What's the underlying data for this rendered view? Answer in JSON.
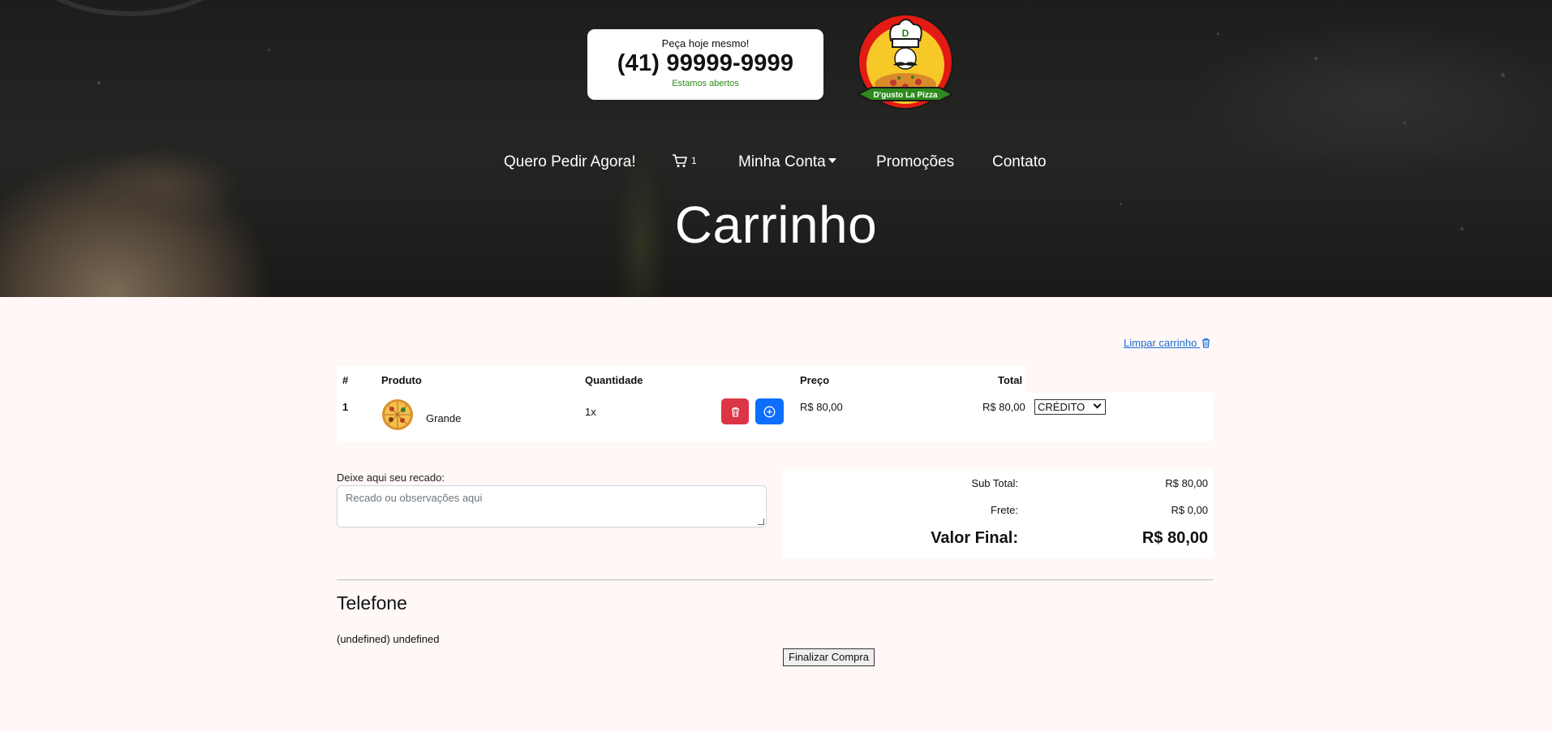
{
  "header": {
    "call_prompt": "Peça hoje mesmo!",
    "phone": "(41) 99999-9999",
    "open_status": "Estamos abertos",
    "logo_text": "D'gusto La Pizza",
    "logo_letter": "D"
  },
  "nav": {
    "order_now": "Quero Pedir Agora!",
    "cart_count": "1",
    "account": "Minha Conta",
    "promotions": "Promoções",
    "contact": "Contato"
  },
  "page_title": "Carrinho",
  "cart": {
    "clear_label": "Limpar carrinho",
    "columns": [
      "#",
      "Produto",
      "Quantidade",
      "Preço",
      "Total"
    ],
    "items": [
      {
        "index": "1",
        "product": "Grande",
        "quantity": "1x",
        "price": "R$ 80,00",
        "total": "R$ 80,00",
        "payment": "CRÉDITO"
      }
    ]
  },
  "notes": {
    "label": "Deixe aqui seu recado:",
    "placeholder": "Recado ou observações aqui"
  },
  "summary": {
    "subtotal_label": "Sub Total:",
    "subtotal": "R$ 80,00",
    "shipping_label": "Frete:",
    "shipping": "R$ 0,00",
    "final_label": "Valor Final:",
    "final": "R$ 80,00"
  },
  "phone_section": {
    "heading": "Telefone",
    "value": "(undefined) undefined"
  },
  "checkout_label": "Finalizar Compra",
  "colors": {
    "accent_green": "#2d8a14",
    "delete_red": "#dc3545",
    "add_blue": "#0d6efd",
    "link_blue": "#1a6dd8"
  }
}
